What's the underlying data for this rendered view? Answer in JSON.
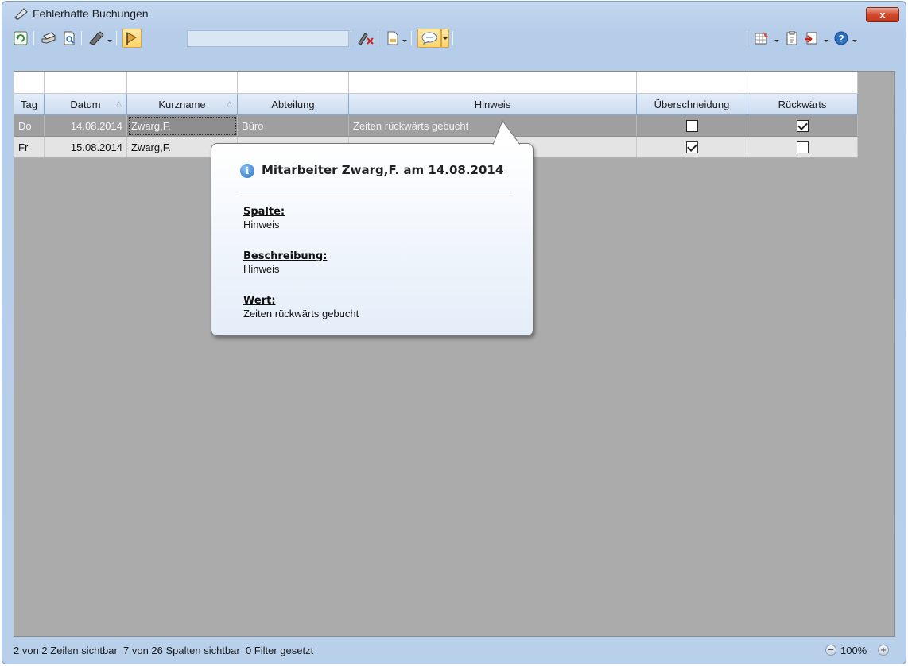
{
  "window": {
    "title": "Fehlerhafte Buchungen",
    "close_label": "x"
  },
  "toolbar": {
    "buttons": [
      "refresh-icon",
      "print-icon",
      "print-preview-icon",
      "edit-icon",
      "filter-pin-icon",
      "clear-filter-icon",
      "export-icon",
      "comment-icon",
      "layout-icon",
      "clipboard-icon",
      "exit-icon",
      "help-icon"
    ],
    "search_value": ""
  },
  "grid": {
    "columns": [
      {
        "label": "Tag"
      },
      {
        "label": "Datum",
        "sorted": true
      },
      {
        "label": "Kurzname",
        "sorted": true
      },
      {
        "label": "Abteilung"
      },
      {
        "label": "Hinweis"
      },
      {
        "label": "Überschneidung"
      },
      {
        "label": "Rückwärts"
      }
    ],
    "rows": [
      {
        "tag": "Do",
        "datum": "14.08.2014",
        "kurzname": "Zwarg,F.",
        "abteilung": "Büro",
        "hinweis": "Zeiten rückwärts gebucht",
        "ueberschneidung": false,
        "rueckwaerts": true
      },
      {
        "tag": "Fr",
        "datum": "15.08.2014",
        "kurzname": "Zwarg,F.",
        "abteilung": "",
        "hinweis": "",
        "ueberschneidung": true,
        "rueckwaerts": false
      }
    ]
  },
  "tooltip": {
    "title": "Mitarbeiter Zwarg,F. am 14.08.2014",
    "spalte_label": "Spalte:",
    "spalte_value": "Hinweis",
    "beschreibung_label": "Beschreibung:",
    "beschreibung_value": "Hinweis",
    "wert_label": "Wert:",
    "wert_value": "Zeiten rückwärts gebucht"
  },
  "status": {
    "text": "2 von 2 Zeilen sichtbar  7 von 26 Spalten sichtbar  0 Filter gesetzt",
    "zoom": "100%"
  },
  "colors": {
    "window_bg": "#b9d0ea",
    "grid_bg": "#ababab",
    "selected_row": "#9f9f9f",
    "close_button": "#d1492d"
  }
}
